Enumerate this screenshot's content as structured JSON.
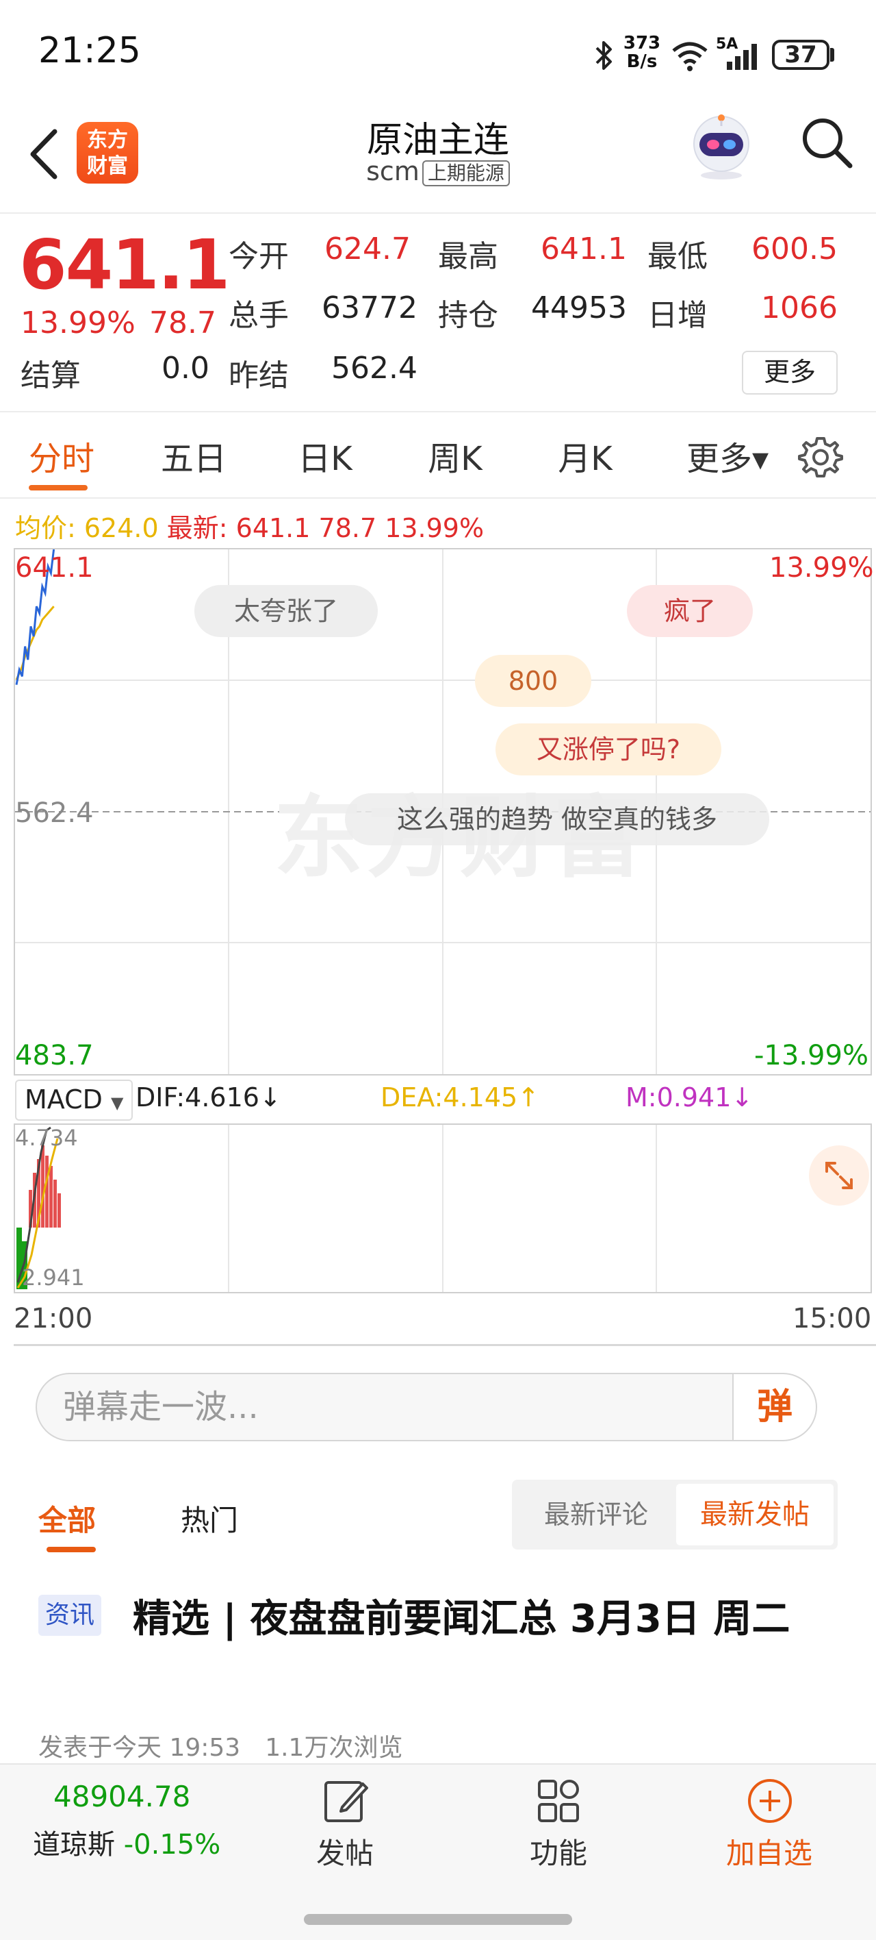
{
  "status_bar": {
    "time": "21:25",
    "net_speed_value": "373",
    "net_speed_unit": "B/s",
    "network_label": "5A",
    "battery": "37"
  },
  "header": {
    "logo_line1": "东方",
    "logo_line2": "财富",
    "title": "原油主连",
    "code": "scm",
    "exchange": "上期能源"
  },
  "quote": {
    "last": "641.1",
    "change_pct": "13.99%",
    "change_val": "78.7",
    "open_label": "今开",
    "open": "624.7",
    "high_label": "最高",
    "high": "641.1",
    "low_label": "最低",
    "low": "600.5",
    "volume_label": "总手",
    "volume": "63772",
    "oi_label": "持仓",
    "oi": "44953",
    "daily_inc_label": "日增",
    "daily_inc": "1066",
    "settle_label": "结算",
    "settle": "0.0",
    "prev_settle_label": "昨结",
    "prev_settle": "562.4",
    "more_label": "更多"
  },
  "tabs": [
    {
      "label": "分时"
    },
    {
      "label": "五日"
    },
    {
      "label": "日K"
    },
    {
      "label": "周K"
    },
    {
      "label": "月K"
    },
    {
      "label": "更多▾"
    }
  ],
  "info_line": {
    "avg_label": "均价: 624.0",
    "latest_label": "最新: 641.1 78.7 13.99%"
  },
  "chart": {
    "y_top": "641.1",
    "y_mid": "562.4",
    "y_bottom": "483.7",
    "pct_top": "13.99%",
    "pct_bottom": "-13.99%",
    "watermark": "东方财富",
    "time_start": "21:00",
    "time_end": "15:00",
    "danmaku": [
      {
        "text": "太夸张了"
      },
      {
        "text": "疯了"
      },
      {
        "text": "800"
      },
      {
        "text": "又涨停了吗?"
      },
      {
        "text": "这么强的趋势 做空真的钱多"
      }
    ],
    "price_series": [
      600.5,
      605,
      603,
      612,
      608,
      618,
      615,
      624,
      622,
      630,
      628,
      636,
      634,
      641.1
    ],
    "avg_series": [
      602,
      604,
      606,
      609,
      611,
      613,
      615,
      617,
      618,
      620,
      621,
      622,
      623,
      624.0
    ]
  },
  "macd": {
    "indicator": "MACD",
    "dif": "DIF:4.616↓",
    "dea": "DEA:4.145↑",
    "m": "M:0.941↓",
    "top": "4.734",
    "bottom": "2.941",
    "colors": {
      "up": "#e45050",
      "down": "#19a019",
      "dif": "#444444",
      "dea": "#e8b400"
    }
  },
  "danmaku_input": {
    "placeholder": "弹幕走一波...",
    "send_label": "弹"
  },
  "feed": {
    "tab_all": "全部",
    "tab_hot": "热门",
    "sort_comment": "最新评论",
    "sort_post": "最新发帖"
  },
  "news": {
    "tag": "资讯",
    "title": "精选 | 夜盘盘前要闻汇总 3月3日 周二",
    "meta": "发表于今天 19:53　1.1万次浏览"
  },
  "bottom_bar": {
    "index_value": "48904.78",
    "index_name": "道琼斯",
    "index_change": "-0.15%",
    "post_label": "发帖",
    "func_label": "功能",
    "watch_label": "加自选"
  },
  "colors": {
    "up": "#e02b2b",
    "down": "#109e10",
    "accent": "#e85a12"
  }
}
